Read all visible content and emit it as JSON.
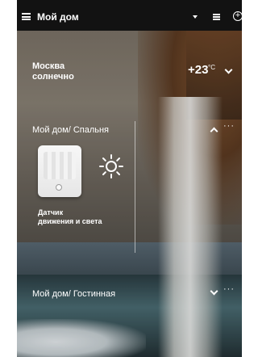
{
  "header": {
    "title": "Мой дом",
    "menu_icon": "hamburger-menu-icon",
    "dropdown_icon": "caret-down-icon",
    "view_icon": "list-view-icon",
    "add_icon": "add-circle-icon"
  },
  "weather": {
    "city": "Москва",
    "condition": "солнечно",
    "temperature": "+23",
    "unit": "°C",
    "icon": "chevron-down-icon"
  },
  "rooms": [
    {
      "title": "Мой дом/ Спальня",
      "expanded": true,
      "more": "···",
      "devices": [
        {
          "label_line1": "Датчик",
          "label_line2": "движения и света",
          "icon": "motion-sensor-icon",
          "state_icon": "sun-icon"
        }
      ]
    },
    {
      "title": "Мой дом/ Гостинная",
      "expanded": false,
      "more": "···"
    }
  ],
  "colors": {
    "topbar": "#121212",
    "text": "#ffffff"
  }
}
